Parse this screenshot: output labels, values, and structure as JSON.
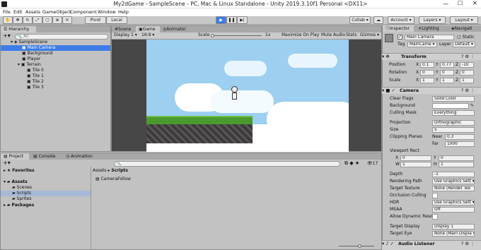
{
  "window": {
    "title": "My2dGame - SampleScene - PC, Mac & Linux Standalone - Unity 2019.3.10f1 Personal <DX11>"
  },
  "menu": [
    "File",
    "Edit",
    "Assets",
    "GameObject",
    "Component",
    "Window",
    "Help"
  ],
  "toolbar": {
    "pivot": "Pivot",
    "local": "Local",
    "collab": "Collab ▾",
    "account": "Account",
    "layers": "Layers",
    "layout": "Layout"
  },
  "hierarchy": {
    "tab": "Hierarchy",
    "search_placeholder": "All",
    "items": [
      {
        "label": "SampleScene",
        "depth": 0
      },
      {
        "label": "Main Camera",
        "depth": 1,
        "selected": true
      },
      {
        "label": "Background",
        "depth": 1
      },
      {
        "label": "Player",
        "depth": 1
      },
      {
        "label": "Terrain",
        "depth": 1
      },
      {
        "label": "Tile 0",
        "depth": 2
      },
      {
        "label": "Tile 1",
        "depth": 2
      },
      {
        "label": "Tile 2",
        "depth": 2
      },
      {
        "label": "Tile 3",
        "depth": 2
      }
    ]
  },
  "game": {
    "tabs": [
      "Scene",
      "Game",
      "Animator"
    ],
    "display": "Display 1",
    "aspect": "16:9",
    "scale_label": "Scale",
    "scale_value": "1x",
    "maximize": "Maximize On Play",
    "mute": "Mute Audio",
    "stats": "Stats",
    "gizmos": "Gizmos"
  },
  "project": {
    "tabs": [
      "Project",
      "Console",
      "Animation"
    ],
    "favorites": "Favorites",
    "assets": "Assets",
    "folders": [
      "Scenes",
      "Scripts",
      "Sprites"
    ],
    "packages": "Packages",
    "breadcrumb_root": "Assets",
    "breadcrumb_leaf": "Scripts",
    "file": "CameraFollow",
    "count": "17"
  },
  "inspector": {
    "tabs": [
      "Inspector",
      "Lighting",
      "Navigati"
    ],
    "object_name": "Main Camera",
    "static": "Static",
    "tag_label": "Tag",
    "tag": "MainCame",
    "layer_label": "Layer",
    "layer": "Default",
    "transform": {
      "title": "Transform",
      "rows": [
        {
          "label": "Position",
          "x": "0.1",
          "y": "0.77",
          "z": "-10"
        },
        {
          "label": "Rotation",
          "x": "0",
          "y": "0",
          "z": "0"
        },
        {
          "label": "Scale",
          "x": "1",
          "y": "1",
          "z": "1"
        }
      ]
    },
    "camera": {
      "title": "Camera",
      "fields": [
        {
          "label": "Clear Flags",
          "value": "Solid Color"
        },
        {
          "label": "Background",
          "value": ""
        },
        {
          "label": "Culling Mask",
          "value": "Everything"
        },
        {
          "label": "Projection",
          "value": "Orthographic"
        },
        {
          "label": "Size",
          "value": "5"
        },
        {
          "label": "Clipping Planes",
          "value": ""
        }
      ],
      "near_label": "Near",
      "near": "0.3",
      "far_label": "Far",
      "far": "1000",
      "viewport_label": "Viewport Rect",
      "vx": "0",
      "vy": "0",
      "vw": "1",
      "vh": "1",
      "fields2": [
        {
          "label": "Depth",
          "value": "-1"
        },
        {
          "label": "Rendering Path",
          "value": "Use Graphics Sett ▾"
        },
        {
          "label": "Target Texture",
          "value": "None (Render Tex"
        },
        {
          "label": "Occlusion Culling",
          "value": ""
        },
        {
          "label": "HDR",
          "value": "Use Graphics Sett ▾"
        },
        {
          "label": "MSAA",
          "value": "Off"
        },
        {
          "label": "Allow Dynamic Resol",
          "value": ""
        },
        {
          "label": "Target Display",
          "value": "Display 1"
        },
        {
          "label": "Target Eye",
          "value": "None (Main Displa ▾"
        }
      ]
    },
    "audio_listener": "Audio Listener"
  },
  "colors": {
    "selected": "#3e7de7",
    "sky": "#9ccff0",
    "grass": "#4a9a2e",
    "rock": "#3c3a3a"
  }
}
